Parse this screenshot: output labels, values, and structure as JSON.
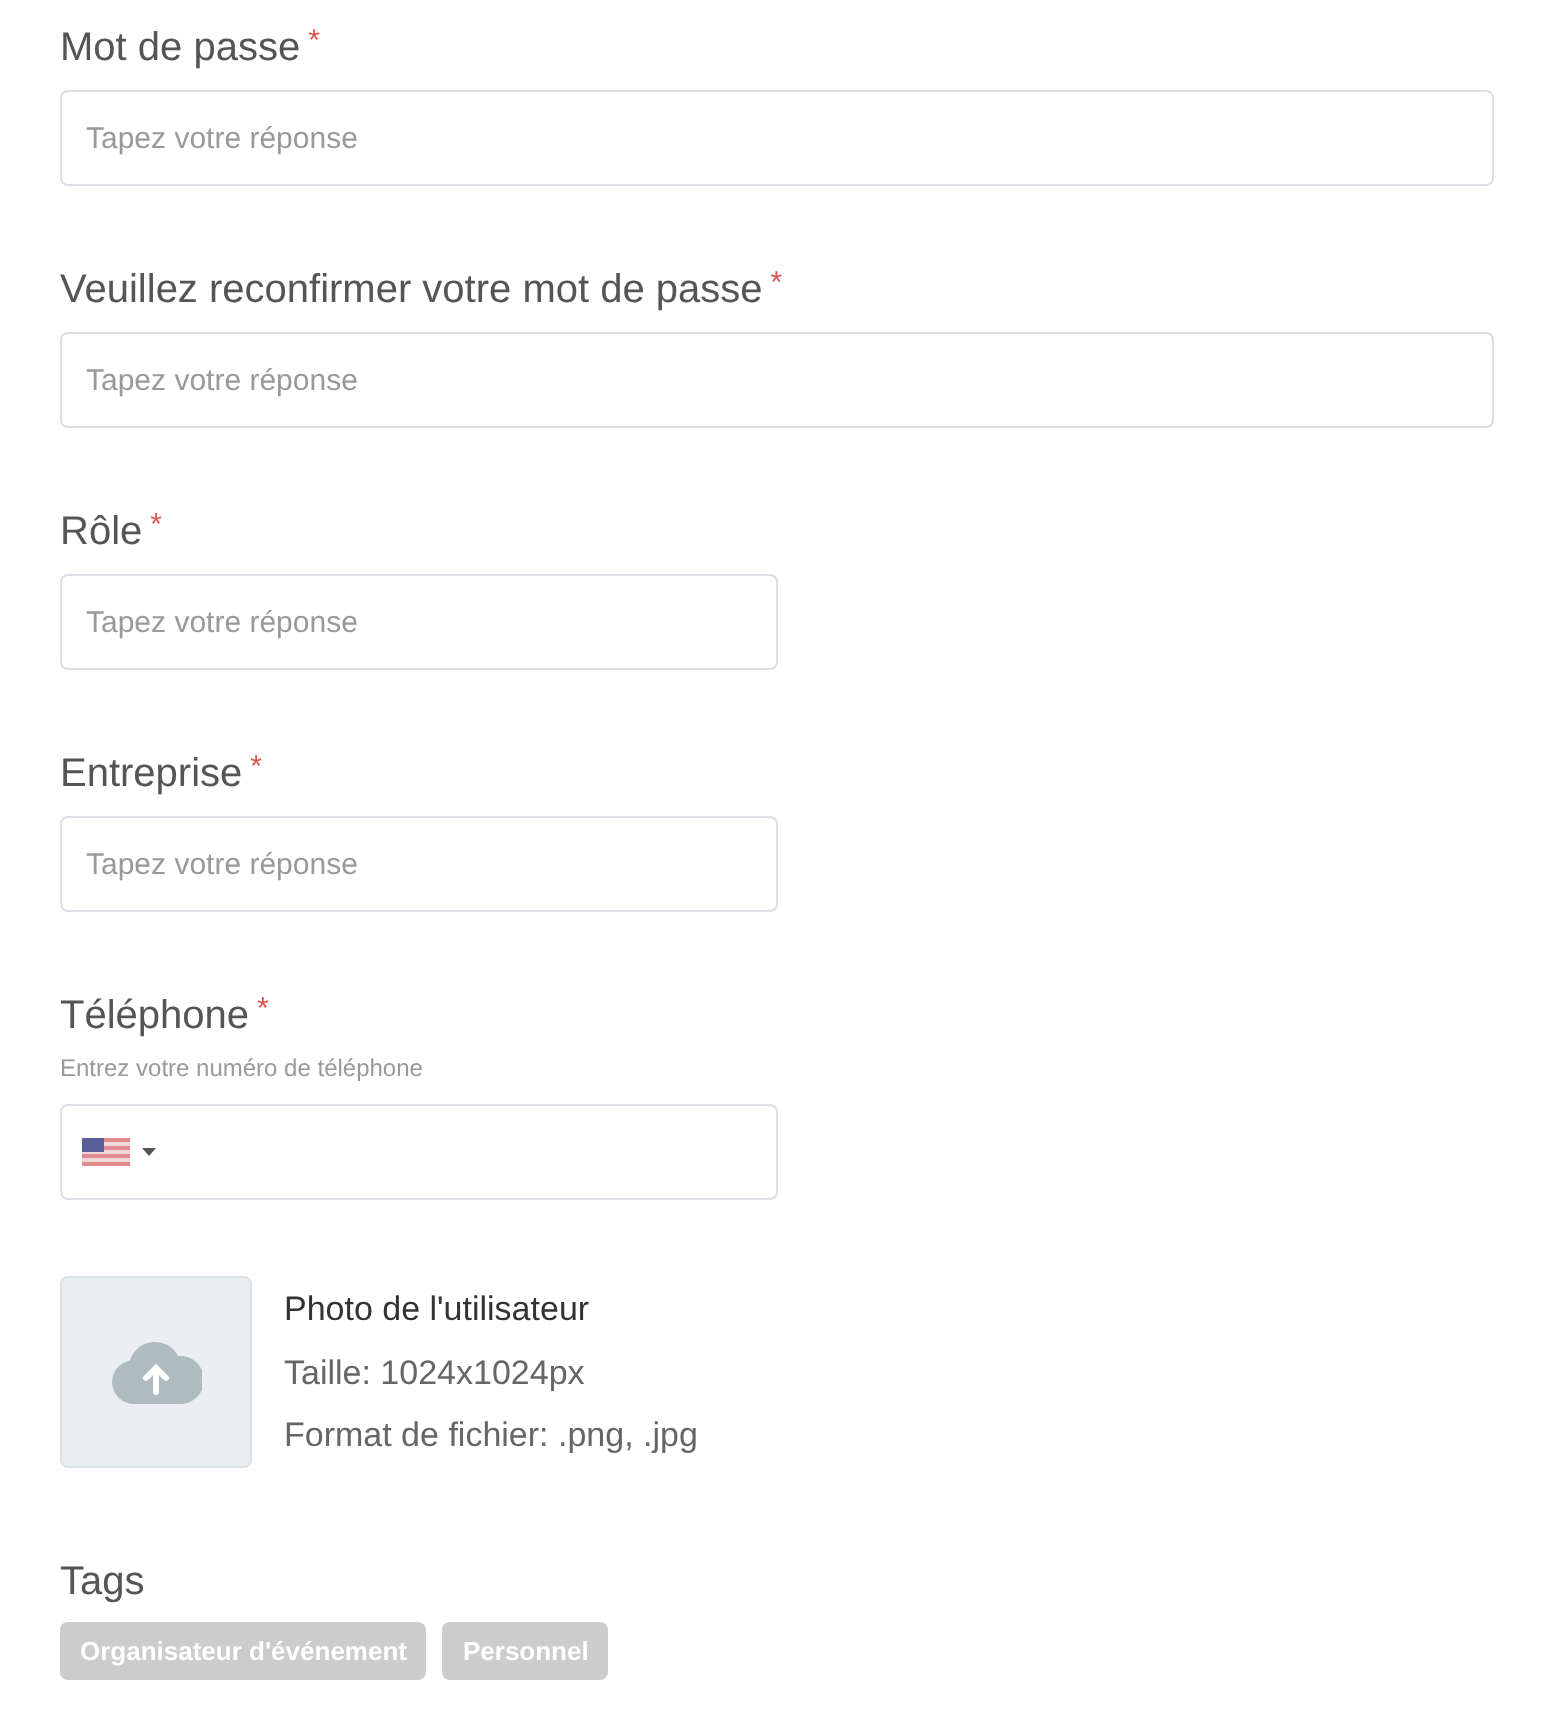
{
  "fields": [
    {
      "kind": "text",
      "label": "Mot de passe",
      "required_mark": "*",
      "placeholder": "Tapez votre réponse",
      "wide": true
    },
    {
      "kind": "text",
      "label": "Veuillez reconfirmer votre mot de passe",
      "required_mark": "*",
      "placeholder": "Tapez votre réponse",
      "wide": true
    },
    {
      "kind": "text",
      "label": "Rôle",
      "required_mark": "*",
      "placeholder": "Tapez votre réponse",
      "wide": false
    },
    {
      "kind": "text",
      "label": "Entreprise",
      "required_mark": "*",
      "placeholder": "Tapez votre réponse",
      "wide": false
    },
    {
      "kind": "phone",
      "label": "Téléphone",
      "required_mark": "*",
      "hint": "Entrez votre numéro de téléphone",
      "wide": false
    }
  ],
  "photo": {
    "title": "Photo de l'utilisateur",
    "lines": [
      "Taille: 1024x1024px",
      "Format de fichier: .png, .jpg"
    ]
  },
  "tags": {
    "label": "Tags",
    "items": [
      "Organisateur d'événement",
      "Personnel"
    ]
  }
}
